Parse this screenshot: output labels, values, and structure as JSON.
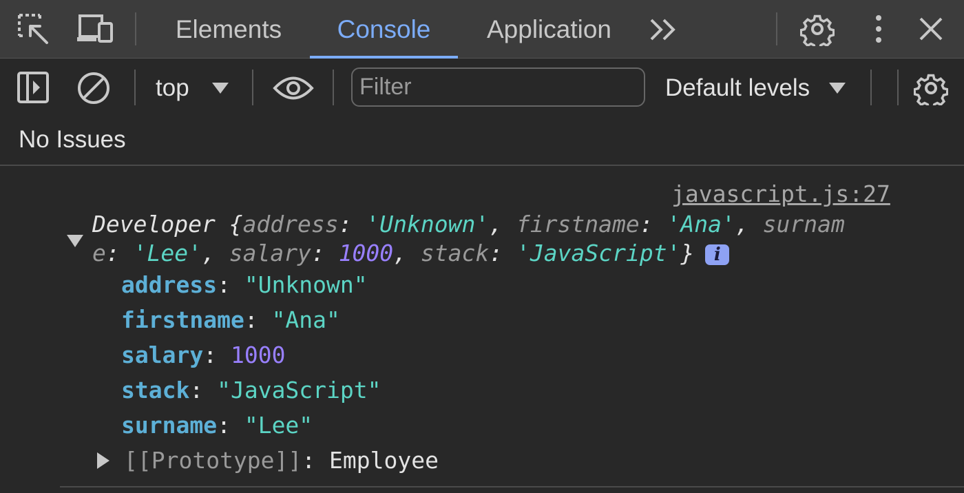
{
  "tabs": [
    {
      "label": "Elements",
      "active": false
    },
    {
      "label": "Console",
      "active": true
    },
    {
      "label": "Application",
      "active": false
    }
  ],
  "toolbar": {
    "context": "top",
    "filter_placeholder": "Filter",
    "levels": "Default levels"
  },
  "issues_text": "No Issues",
  "log": {
    "source": "javascript.js:27",
    "summary_line1": {
      "class_name": "Developer",
      "open_brace": " {",
      "k_address": "address",
      "v_address": "'Unknown'",
      "k_firstname": "firstname",
      "v_firstname": "'Ana'",
      "k_surname_part": "surnam"
    },
    "summary_line2": {
      "k_surname_rest": "e",
      "v_surname": "'Lee'",
      "k_salary": "salary",
      "v_salary": "1000",
      "k_stack": "stack",
      "v_stack": "'JavaScript'",
      "close_brace": "}"
    },
    "info_badge": "i",
    "properties": [
      {
        "key": "address",
        "value": "\"Unknown\"",
        "type": "string"
      },
      {
        "key": "firstname",
        "value": "\"Ana\"",
        "type": "string"
      },
      {
        "key": "salary",
        "value": "1000",
        "type": "number"
      },
      {
        "key": "stack",
        "value": "\"JavaScript\"",
        "type": "string"
      },
      {
        "key": "surname",
        "value": "\"Lee\"",
        "type": "string"
      }
    ],
    "prototype": {
      "key": "[[Prototype]]",
      "value": "Employee"
    }
  },
  "colors": {
    "accent": "#7cacf8",
    "key": "#5db0d7",
    "string": "#5cd5c5",
    "number": "#9980ff"
  }
}
